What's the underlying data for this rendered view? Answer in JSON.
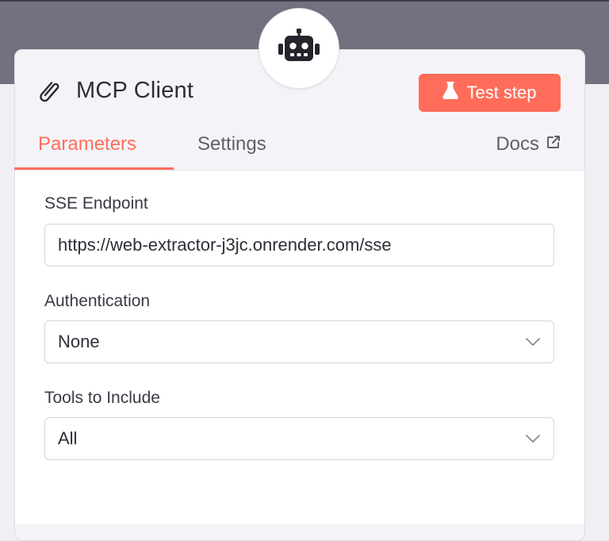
{
  "node": {
    "icon": "robot-icon",
    "title_icon": "paperclip-icon",
    "title": "MCP Client",
    "test_button": {
      "label": "Test step",
      "icon": "flask-icon"
    }
  },
  "tabs": [
    {
      "label": "Parameters",
      "active": true
    },
    {
      "label": "Settings",
      "active": false
    }
  ],
  "docs": {
    "label": "Docs",
    "icon": "external-link-icon"
  },
  "fields": {
    "sse_endpoint": {
      "label": "SSE Endpoint",
      "value": "https://web-extractor-j3jc.onrender.com/sse"
    },
    "authentication": {
      "label": "Authentication",
      "value": "None"
    },
    "tools": {
      "label": "Tools to Include",
      "value": "All"
    }
  },
  "colors": {
    "accent": "#ff6d5a",
    "backdrop": "#73717f",
    "panel": "#f4f4f8"
  }
}
